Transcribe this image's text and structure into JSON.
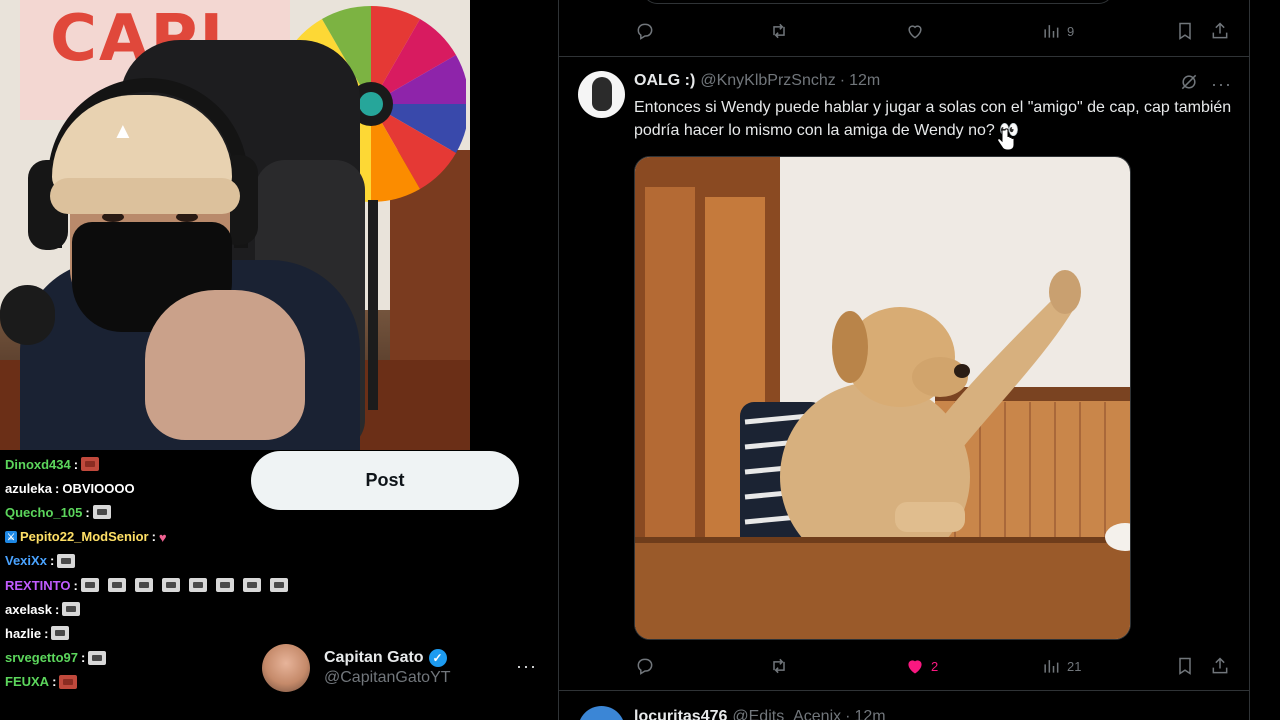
{
  "webcam": {
    "poster_text": "CAPI"
  },
  "chat": {
    "messages": [
      {
        "user": "Dinoxd434",
        "color": "#5cd65c",
        "text": "",
        "emotes": [
          "red"
        ]
      },
      {
        "user": "azuleka",
        "color": "#ffffff",
        "text": "OBVIOOOO",
        "emotes": []
      },
      {
        "user": "Quecho_105",
        "color": "#5cd65c",
        "text": "",
        "emotes": [
          "grey"
        ]
      },
      {
        "user": "Pepito22_ModSenior",
        "color": "#ffe066",
        "text": "",
        "emotes": [
          "pink"
        ],
        "badge": "mod"
      },
      {
        "user": "VexiXx",
        "color": "#4aa3ff",
        "text": "",
        "emotes": [
          "grey"
        ]
      },
      {
        "user": "REXTINTO",
        "color": "#c15cff",
        "text": "",
        "emotes": [
          "grey",
          "grey",
          "grey",
          "grey",
          "grey",
          "grey",
          "grey",
          "grey"
        ]
      },
      {
        "user": "axelask",
        "color": "#ffffff",
        "text": "",
        "emotes": [
          "grey"
        ]
      },
      {
        "user": "hazlie",
        "color": "#ffffff",
        "text": "",
        "emotes": [
          "grey"
        ]
      },
      {
        "user": "srvegetto97",
        "color": "#5cd65c",
        "text": "",
        "emotes": [
          "grey"
        ]
      },
      {
        "user": "FEUXA",
        "color": "#5cd65c",
        "text": "",
        "emotes": [
          "red"
        ]
      }
    ]
  },
  "compose": {
    "post_label": "Post"
  },
  "account": {
    "name": "Capitan Gato",
    "handle": "@CapitanGatoYT",
    "more": "···"
  },
  "prev_tweet": {
    "views": "9"
  },
  "tweet": {
    "name": "OALG :)",
    "handle": "@KnyKlbPrzSnchz",
    "time": "12m",
    "text": "Entonces si Wendy puede hablar y jugar a solas con el \"amigo\" de cap, cap también podría hacer lo mismo con la amiga de Wendy no? 👀",
    "likes": "2",
    "views": "21",
    "liked": true
  },
  "next_tweet": {
    "name": "locuritas476",
    "handle": "@Edits_Acenix",
    "time": "12m"
  },
  "colors": {
    "background": "#000000",
    "border": "#2f3336",
    "muted": "#71767b",
    "like": "#f91880",
    "verified": "#1d9bf0"
  }
}
